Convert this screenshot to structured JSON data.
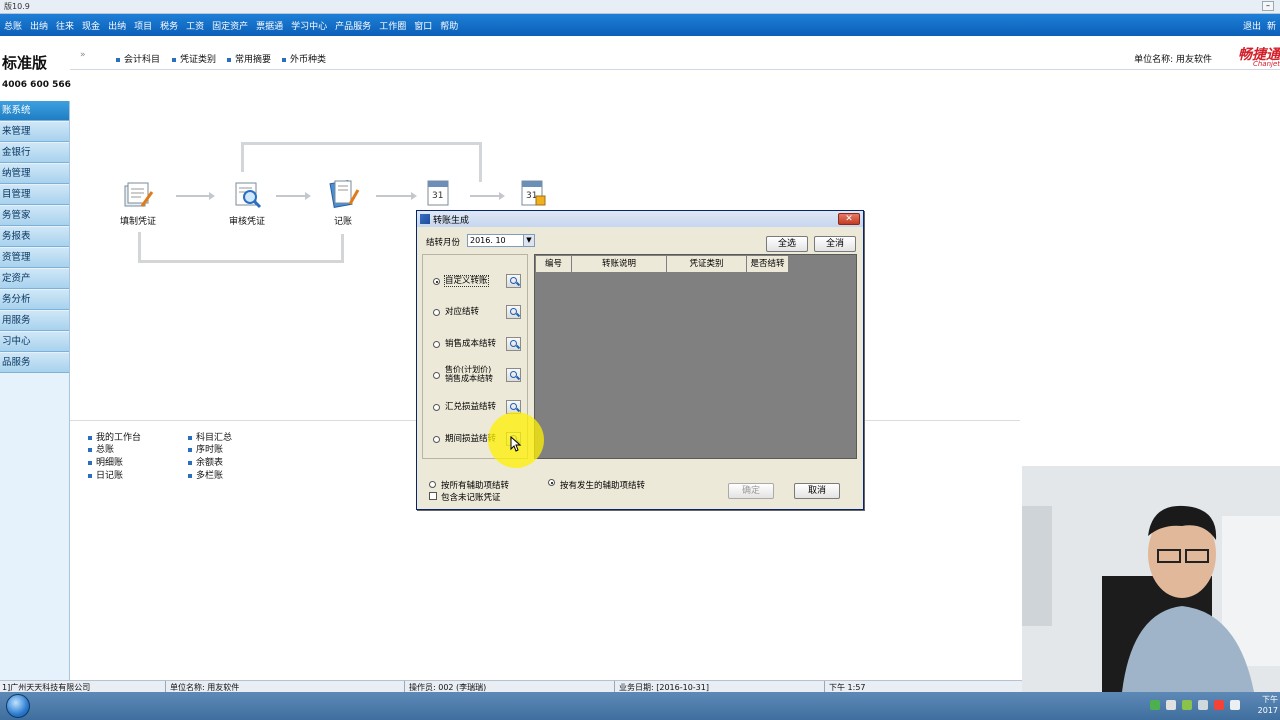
{
  "window": {
    "title": "版10.9",
    "controls": [
      "–"
    ]
  },
  "menubar": {
    "items": [
      "总账",
      "出纳",
      "往来",
      "现金",
      "出纳",
      "项目",
      "税务",
      "工资",
      "固定资产",
      "票据通",
      "学习中心",
      "产品服务",
      "工作圈",
      "窗口",
      "帮助"
    ],
    "right_items": [
      "退出",
      "新"
    ]
  },
  "brand": {
    "edition": "标准版",
    "hotline": "4006 600 566"
  },
  "sidebar": {
    "items": [
      {
        "label": "账系统",
        "active": true
      },
      {
        "label": "来管理"
      },
      {
        "label": "金银行"
      },
      {
        "label": "纳管理"
      },
      {
        "label": "目管理"
      },
      {
        "label": "务管家"
      },
      {
        "label": "务报表"
      },
      {
        "label": "资管理"
      },
      {
        "label": "定资产"
      },
      {
        "label": "务分析"
      },
      {
        "label": "用服务"
      },
      {
        "label": "习中心"
      },
      {
        "label": "品服务"
      }
    ]
  },
  "quickbar": {
    "chevron": "»",
    "links": [
      "会计科目",
      "凭证类别",
      "常用摘要",
      "外币种类"
    ],
    "unit": "单位名称: 用友软件",
    "brand_logo": "畅捷通",
    "brand_sub": "Chanjet"
  },
  "flow": {
    "steps": [
      {
        "label": "填制凭证",
        "icon": "fill-voucher-icon"
      },
      {
        "label": "审核凭证",
        "icon": "audit-voucher-icon"
      },
      {
        "label": "记账",
        "icon": "post-ledger-icon"
      },
      {
        "label": "",
        "icon": "month-end-transfer-icon"
      },
      {
        "label": "",
        "icon": "month-end-close-icon"
      }
    ]
  },
  "reports": {
    "col1": [
      "我的工作台",
      "总账",
      "明细账",
      "日记账"
    ],
    "col2": [
      "科目汇总",
      "序时账",
      "余额表",
      "多栏账"
    ]
  },
  "dialog": {
    "title": "转账生成",
    "month_label": "结转月份",
    "month_value": "2016. 10",
    "select_all": "全选",
    "clear_all": "全消",
    "options": [
      {
        "label": "自定义转账",
        "selected": true
      },
      {
        "label": "对应结转",
        "selected": false
      },
      {
        "label": "销售成本结转",
        "selected": false
      },
      {
        "label": "售价(计划价)\n销售成本结转",
        "selected": false
      },
      {
        "label": "汇兑损益结转",
        "selected": false
      },
      {
        "label": "期间损益结转",
        "selected": false
      }
    ],
    "grid_columns": [
      "编号",
      "转账说明",
      "凭证类别",
      "是否结转"
    ],
    "radio_all_aux": "按所有辅助项结转",
    "radio_occurred_aux": "按有发生的辅助项结转",
    "include_unposted": "包含未记账凭证",
    "ok": "确定",
    "cancel": "取消"
  },
  "statusbar": {
    "company": "1]广州天天科技有限公司",
    "unit": "单位名称: 用友软件",
    "operator": "操作员: 002 (李瑞瑞)",
    "business_date": "业务日期: [2016-10-31]",
    "time": "下午 1:57"
  },
  "taskbar": {
    "clock_line1": "下午",
    "clock_line2": "2017"
  },
  "colors": {
    "menubar": "#0b5fb8",
    "sidebar": "#a8d2ee",
    "dialog_bg": "#ece9d8",
    "grid_bg": "#808080",
    "brand_red": "#d3202b"
  }
}
